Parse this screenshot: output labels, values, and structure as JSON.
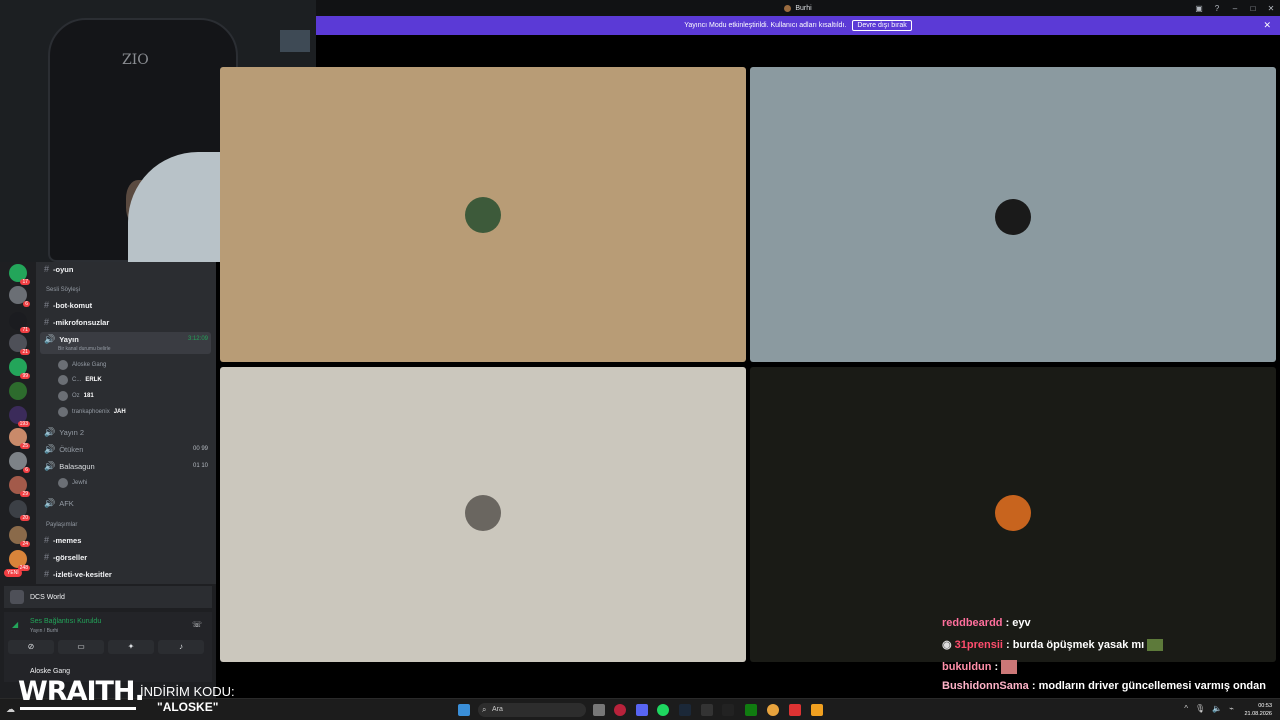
{
  "window": {
    "title": "Burhi",
    "controls": [
      "inbox-icon",
      "help-icon",
      "minimize-icon",
      "maximize-icon",
      "close-icon"
    ]
  },
  "banner": {
    "text": "Yayıncı Modu etkinleştirildi. Kullanıcı adları kısaltıldı.",
    "button": "Devre dışı bırak",
    "color": "#5b3ad6"
  },
  "sidebar": {
    "server_badges": [
      "17",
      "6",
      "71",
      "21",
      "99",
      "193",
      "25",
      "6",
      "29",
      "20",
      "24",
      "248"
    ],
    "new_badge": "YENİ",
    "channels": {
      "oyun": "-oyun",
      "category_sesli": "Sesli Söyleşi",
      "bot_komut": "-bot-komut",
      "mikrofonsuzlar": "-mikrofonsuzlar",
      "yayin": "Yayın",
      "yayin_status": "Bir kanal durumu belirle",
      "yayin_timer": "3:12:09",
      "members": [
        {
          "name": "Aloske Gang",
          "tag": ""
        },
        {
          "name": "C...",
          "tag": "ERLK"
        },
        {
          "name": "Oz",
          "tag": "181"
        },
        {
          "name": "trankaphoenix",
          "tag": "JAH"
        }
      ],
      "yayin2": "Yayın 2",
      "otuken": "Ötüken",
      "otuken_count": "00 99",
      "balasagun": "Balasagun",
      "balasagun_count": "01 10",
      "jewhi": "Jewhi",
      "afk": "AFK",
      "category_paylasimlar": "Paylaşımlar",
      "memes": "-memes",
      "gorseller": "-görseller",
      "izleti": "-izleti-ve-kesitler"
    },
    "server_name": "DCS World",
    "voice": {
      "status": "Ses Bağlantısı Kuruldu",
      "sub": "Yayın / Burhi"
    },
    "user": {
      "name": "Aloske Gang"
    }
  },
  "webcam": {
    "chair_brand": "ZIO"
  },
  "chat": [
    {
      "user": "reddbeardd",
      "message": "eyv"
    },
    {
      "user": "31prensii",
      "message": "burda öpüşmek yasak mı"
    },
    {
      "user": "bukuldun",
      "message": ""
    },
    {
      "user": "BushidonnSama",
      "message": "modların driver güncellemesi varmış ondan"
    }
  ],
  "overlay": {
    "brand": "WRAITH.",
    "promo_label": "İNDİRİM KODU:",
    "promo_code": "\"ALOSKE\""
  },
  "taskbar": {
    "search_placeholder": "Ara",
    "time": "00:53",
    "date": "21.08.2026"
  },
  "tiles": [
    {
      "bg": "#b89c76",
      "avatar": "turban-man-avatar"
    },
    {
      "bg": "#8b9aa0",
      "avatar": "bird-avatar"
    },
    {
      "bg": "#cbc7bd",
      "avatar": "cat-avatar"
    },
    {
      "bg": "#1a1b16",
      "avatar": "phoenix-avatar"
    }
  ]
}
